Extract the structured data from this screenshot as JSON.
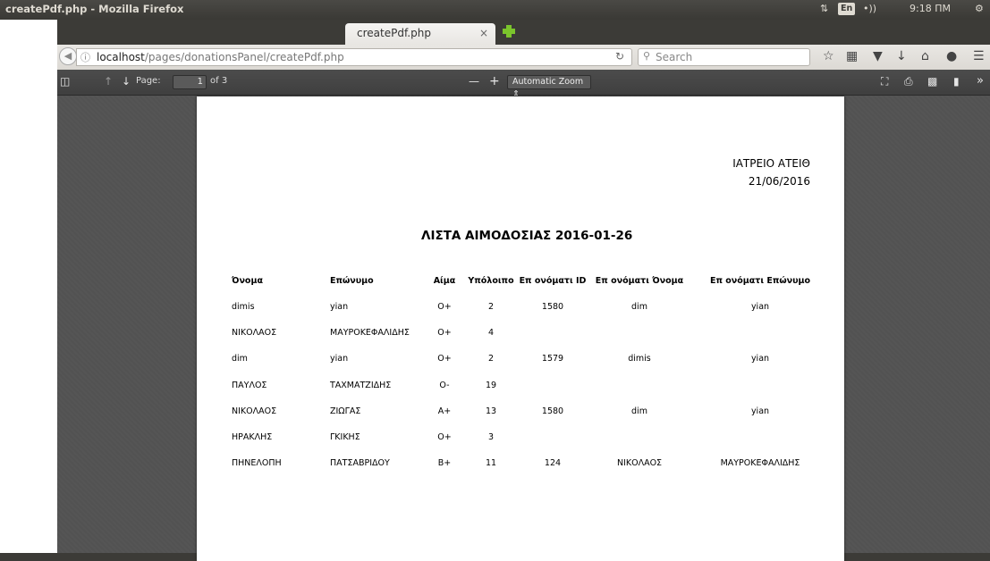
{
  "system_panel": {
    "window_title": "createPdf.php - Mozilla Firefox",
    "keyboard_layout": "En",
    "volume": "•))",
    "clock": "9:18 ΠΜ"
  },
  "browser": {
    "tab_title": "createPdf.php",
    "tab_close": "×",
    "url_host": "localhost",
    "url_path": "/pages/donationsPanel/createPdf.php",
    "search_placeholder": "Search"
  },
  "pdf_toolbar": {
    "page_label": "Page:",
    "page_number": "1",
    "page_of": "of 3",
    "zoom_label": "Automatic Zoom"
  },
  "document": {
    "clinic": "ΙΑΤΡΕΙΟ ΑΤΕΙΘ",
    "date": "21/06/2016",
    "title": "ΛΙΣΤΑ ΑΙΜΟΔΟΣΙΑΣ 2016-01-26",
    "columns": [
      "Όνομα",
      "Επώνυμο",
      "Αίμα",
      "Υπόλοιπο",
      "Επ ονόματι ID",
      "Επ ονόματι Όνομα",
      "Επ ονόματι Επώνυμο"
    ],
    "rows": [
      [
        "dimis",
        "yian",
        "O+",
        "2",
        "1580",
        "dim",
        "yian"
      ],
      [
        "ΝΙΚΟΛΑΟΣ",
        "ΜΑΥΡΟΚΕΦΑΛΙΔΗΣ",
        "O+",
        "4",
        "",
        "",
        ""
      ],
      [
        "dim",
        "yian",
        "O+",
        "2",
        "1579",
        "dimis",
        "yian"
      ],
      [
        "ΠΑΥΛΟΣ",
        "ΤΑΧΜΑΤΖΙΔΗΣ",
        "O-",
        "19",
        "",
        "",
        ""
      ],
      [
        "ΝΙΚΟΛΑΟΣ",
        "ΖΙΩΓΑΣ",
        "A+",
        "13",
        "1580",
        "dim",
        "yian"
      ],
      [
        "ΗΡΑΚΛΗΣ",
        "ΓΚΙΚΗΣ",
        "O+",
        "3",
        "",
        "",
        ""
      ],
      [
        "ΠΗΝΕΛΟΠΗ",
        "ΠΑΤΣΑΒΡΙΔΟΥ",
        "B+",
        "11",
        "124",
        "ΝΙΚΟΛΑΟΣ",
        "ΜΑΥΡΟΚΕΦΑΛΙΔΗΣ"
      ]
    ]
  }
}
